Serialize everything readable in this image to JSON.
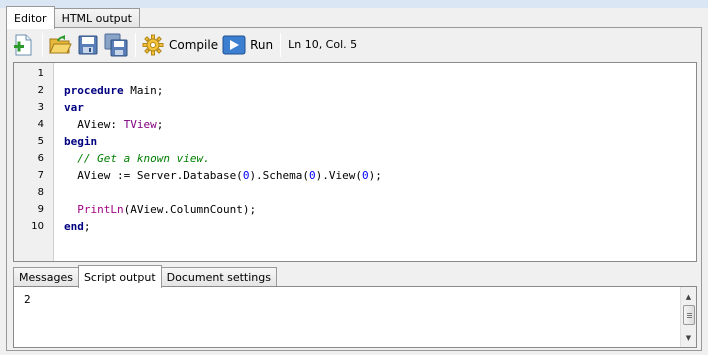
{
  "top_tabs": [
    "Editor",
    "HTML output"
  ],
  "toolbar": {
    "new_icon": "new-script-icon",
    "open_icon": "open-folder-icon",
    "save_icon": "save-icon",
    "save_all_icon": "save-all-icon",
    "compile_label": "Compile",
    "compile_icon": "gear-icon",
    "run_label": "Run",
    "run_icon": "play-icon",
    "cursor_status": "Ln 10, Col. 5"
  },
  "editor": {
    "line_numbers": [
      "1",
      "2",
      "3",
      "4",
      "5",
      "6",
      "7",
      "8",
      "9",
      "10"
    ],
    "code": {
      "l2_kw": "procedure",
      "l2_rest": " Main;",
      "l3_kw": "var",
      "l4_a": "  AView: ",
      "l4_type": "TView",
      "l4_b": ";",
      "l5_kw": "begin",
      "l6_comment": "  // Get a known view.",
      "l7_a": "  AView := Server.Database(",
      "l7_n1": "0",
      "l7_b": ").Schema(",
      "l7_n2": "0",
      "l7_c": ").View(",
      "l7_n3": "0",
      "l7_d": ");",
      "l9_a": "  ",
      "l9_fn": "PrintLn",
      "l9_b": "(AView.ColumnCount);",
      "l10_kw": "end",
      "l10_b": ";"
    }
  },
  "bottom_tabs": [
    "Messages",
    "Script output",
    "Document settings"
  ],
  "output": {
    "text": "2"
  },
  "colors": {
    "keyword": "#000080",
    "type": "#800080",
    "comment": "#008000",
    "function": "#a00080",
    "number": "#0000ff"
  }
}
